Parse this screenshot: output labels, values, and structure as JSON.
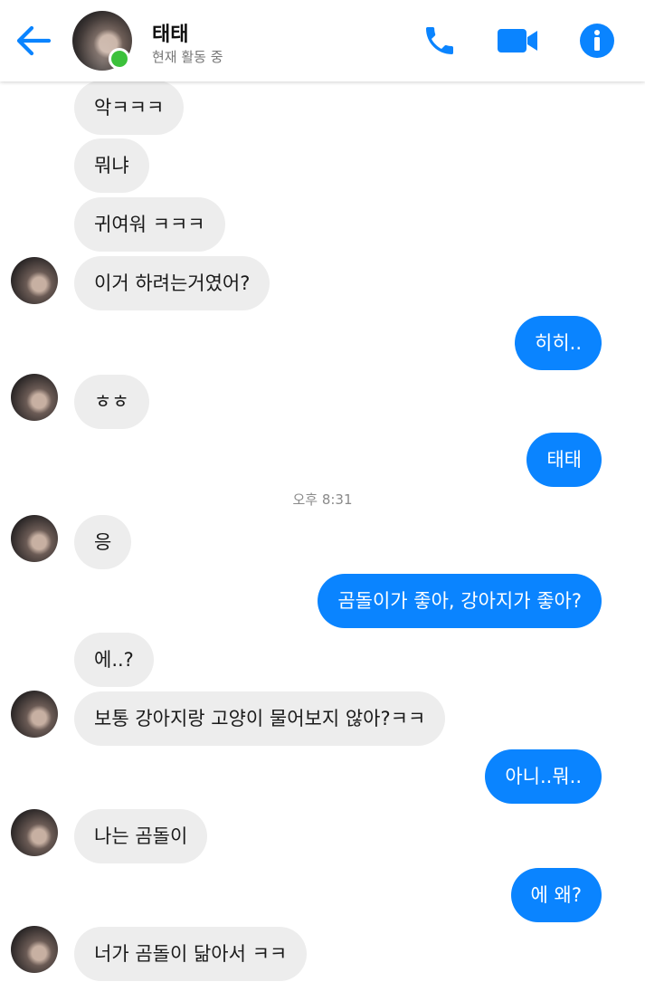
{
  "header": {
    "name": "태태",
    "status": "현재 활동 중",
    "icons": {
      "back": "back-arrow-icon",
      "call": "phone-icon",
      "video": "video-camera-icon",
      "info": "info-icon"
    },
    "accent_color": "#0a84ff",
    "online_color": "#3cc13b"
  },
  "timestamp": "오후 8:31",
  "messages": [
    {
      "from": "them",
      "text": "악ㅋㅋㅋ"
    },
    {
      "from": "them",
      "text": "뭐냐"
    },
    {
      "from": "them",
      "text": "귀여워 ㅋㅋㅋ"
    },
    {
      "from": "them",
      "text": "이거 하려는거였어?"
    },
    {
      "from": "me",
      "text": "히히.."
    },
    {
      "from": "them",
      "text": "ㅎㅎ"
    },
    {
      "from": "me",
      "text": "태태"
    },
    {
      "from": "them",
      "text": "응"
    },
    {
      "from": "me",
      "text": "곰돌이가 좋아, 강아지가 좋아?"
    },
    {
      "from": "them",
      "text": "에..?"
    },
    {
      "from": "them",
      "text": "보통 강아지랑 고양이 물어보지 않아?ㅋㅋ"
    },
    {
      "from": "me",
      "text": "아니..뭐.."
    },
    {
      "from": "them",
      "text": "나는 곰돌이"
    },
    {
      "from": "me",
      "text": "에 왜?"
    },
    {
      "from": "them",
      "text": "너가 곰돌이 닮아서 ㅋㅋ"
    }
  ]
}
